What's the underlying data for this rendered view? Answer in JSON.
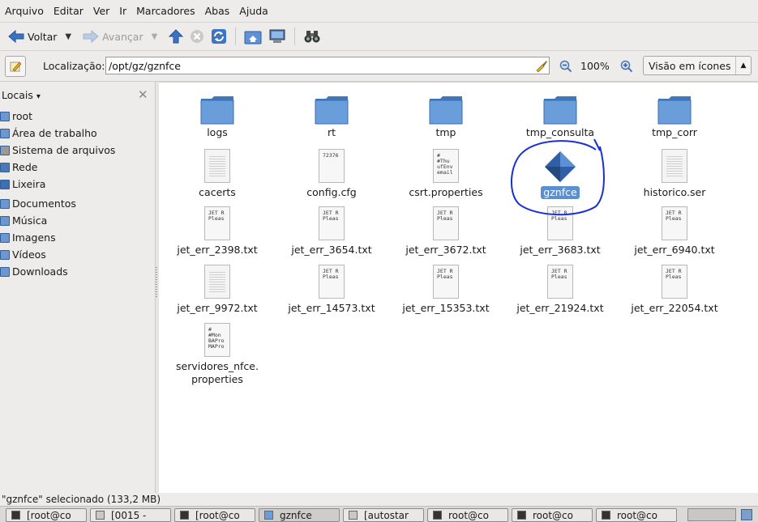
{
  "menubar": {
    "items": [
      "Arquivo",
      "Editar",
      "Ver",
      "Ir",
      "Marcadores",
      "Abas",
      "Ajuda"
    ]
  },
  "toolbar": {
    "back_label": "Voltar",
    "forward_label": "Avançar"
  },
  "location": {
    "label": "Localização:",
    "path": "/opt/gz/gznfce",
    "zoom": "100%",
    "view_mode": "Visão em ícones"
  },
  "sidebar": {
    "title": "Locais",
    "items": [
      {
        "label": "root",
        "icon": "home-folder-icon"
      },
      {
        "label": "Área de trabalho",
        "icon": "desktop-folder-icon"
      },
      {
        "label": "Sistema de arquivos",
        "icon": "drive-icon"
      },
      {
        "label": "Rede",
        "icon": "network-icon"
      },
      {
        "label": "Lixeira",
        "icon": "trash-icon"
      },
      {
        "label": "Documentos",
        "icon": "documents-folder-icon"
      },
      {
        "label": "Música",
        "icon": "music-folder-icon"
      },
      {
        "label": "Imagens",
        "icon": "pictures-folder-icon"
      },
      {
        "label": "Vídeos",
        "icon": "videos-folder-icon"
      },
      {
        "label": "Downloads",
        "icon": "downloads-folder-icon"
      }
    ]
  },
  "files": [
    {
      "name": "logs",
      "kind": "folder"
    },
    {
      "name": "rt",
      "kind": "folder"
    },
    {
      "name": "tmp",
      "kind": "folder"
    },
    {
      "name": "tmp_consulta",
      "kind": "folder"
    },
    {
      "name": "tmp_corr",
      "kind": "folder"
    },
    {
      "name": "cacerts",
      "kind": "lines"
    },
    {
      "name": "config.cfg",
      "kind": "text",
      "preview": "72376"
    },
    {
      "name": "csrt.properties",
      "kind": "text",
      "preview": "#\n#Thu\nufEnv\nemail"
    },
    {
      "name": "gznfce",
      "kind": "executable",
      "selected": true
    },
    {
      "name": "historico.ser",
      "kind": "lines"
    },
    {
      "name": "jet_err_2398.txt",
      "kind": "text",
      "preview": "JET R\nPleas"
    },
    {
      "name": "jet_err_3654.txt",
      "kind": "text",
      "preview": "JET R\nPleas"
    },
    {
      "name": "jet_err_3672.txt",
      "kind": "text",
      "preview": "JET R\nPleas"
    },
    {
      "name": "jet_err_3683.txt",
      "kind": "text",
      "preview": "JET R\nPleas"
    },
    {
      "name": "jet_err_6940.txt",
      "kind": "text",
      "preview": "JET R\nPleas"
    },
    {
      "name": "jet_err_9972.txt",
      "kind": "lines"
    },
    {
      "name": "jet_err_14573.txt",
      "kind": "text",
      "preview": "JET R\nPleas"
    },
    {
      "name": "jet_err_15353.txt",
      "kind": "text",
      "preview": "JET R\nPleas"
    },
    {
      "name": "jet_err_21924.txt",
      "kind": "text",
      "preview": "JET R\nPleas"
    },
    {
      "name": "jet_err_22054.txt",
      "kind": "text",
      "preview": "JET R\nPleas"
    },
    {
      "name": "servidores_nfce.\nproperties",
      "kind": "text",
      "preview": "#\n#Mon\nBAPro\nMAPro"
    }
  ],
  "status": {
    "text": "\"gznfce\" selecionado (133,2 MB)"
  },
  "taskbar": {
    "tasks": [
      {
        "label": "[root@co",
        "icon": "terminal-icon"
      },
      {
        "label": "[0015 -",
        "icon": "window-icon"
      },
      {
        "label": "[root@co",
        "icon": "terminal-icon"
      },
      {
        "label": "gznfce",
        "icon": "folder-window-icon"
      },
      {
        "label": "[autostar",
        "icon": "editor-icon"
      },
      {
        "label": "root@co",
        "icon": "terminal-icon"
      },
      {
        "label": "root@co",
        "icon": "terminal-icon"
      },
      {
        "label": "root@co",
        "icon": "terminal-icon"
      }
    ]
  },
  "colors": {
    "selection": "#5b8fd0",
    "annotation": "#1a2fd6",
    "folder": "#4f86c6"
  }
}
